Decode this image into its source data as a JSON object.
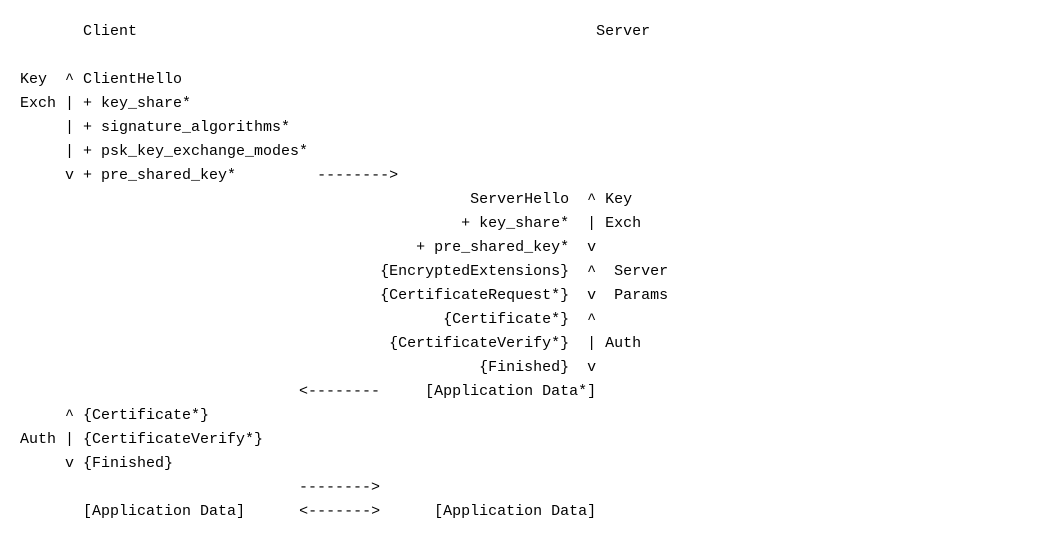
{
  "header": {
    "client": "Client",
    "server": "Server"
  },
  "client_key_exch": {
    "phase_line1": "Key",
    "phase_line2": "Exch",
    "msg1": "ClientHello",
    "msg2": "+ key_share*",
    "msg3": "+ signature_algorithms*",
    "msg4": "+ psk_key_exchange_modes*",
    "msg5": "+ pre_shared_key*",
    "arrow": "-------->"
  },
  "server_block": {
    "key_exch_label1": "Key",
    "key_exch_label2": "Exch",
    "params_label1": "Server",
    "params_label2": "Params",
    "auth_label": "Auth",
    "msg1": "ServerHello",
    "msg2": "+ key_share*",
    "msg3": "+ pre_shared_key*",
    "msg4": "{EncryptedExtensions}",
    "msg5": "{CertificateRequest*}",
    "msg6": "{Certificate*}",
    "msg7": "{CertificateVerify*}",
    "msg8": "{Finished}",
    "msg9": "[Application Data*]",
    "arrow": "<--------"
  },
  "client_auth": {
    "phase_label": "Auth",
    "msg1": "{Certificate*}",
    "msg2": "{CertificateVerify*}",
    "msg3": "{Finished}",
    "arrow": "-------->"
  },
  "app_data": {
    "client": "[Application Data]",
    "server": "[Application Data]",
    "arrow": "<------->"
  }
}
